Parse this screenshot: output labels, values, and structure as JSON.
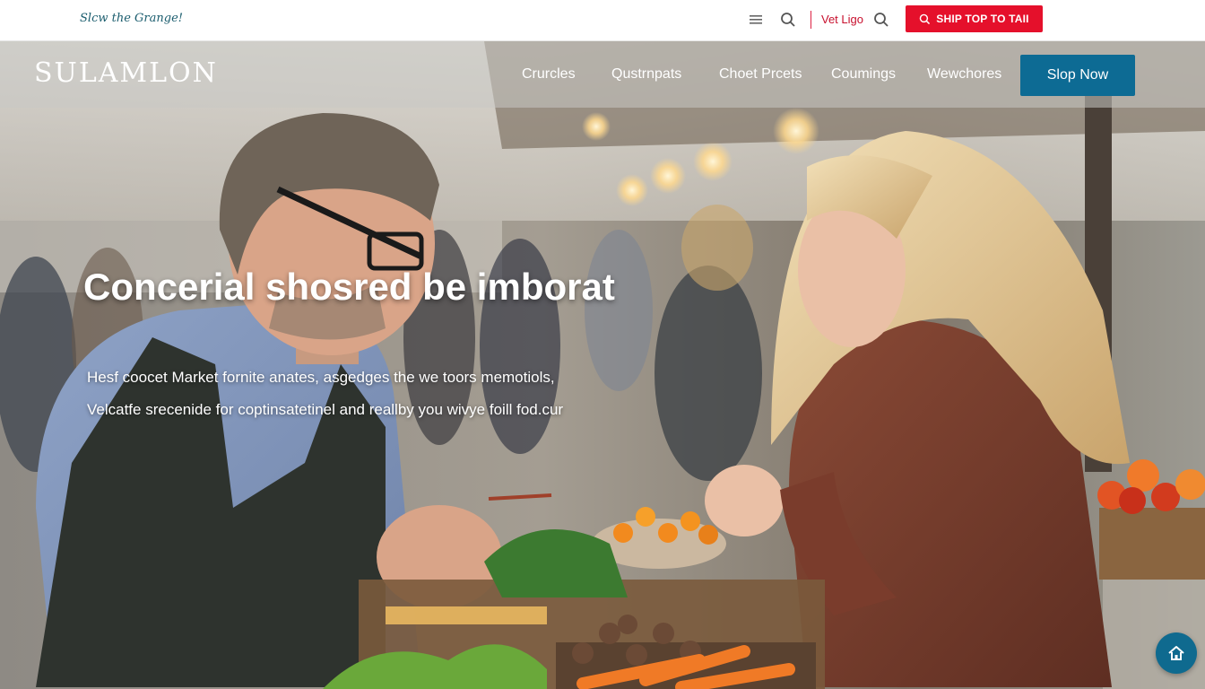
{
  "topbar": {
    "tagline": "Slcw the Grange!",
    "vet_link": "Vet Ligo",
    "shop_button": "SHIP TOP TO TAII"
  },
  "mainnav": {
    "logo": "SULAMLON",
    "items": [
      "Crurcles",
      "Qustrnpats",
      "Choet Prcets",
      "Coumings",
      "Wewchores"
    ],
    "cta": "Slop Now"
  },
  "hero": {
    "headline": "Concerial shosred be imborat",
    "sub_1": "Hesf coocet Market fornite anates, asgedges the we toors memotiols,",
    "sub_2": "Velcatfe srecenide for coptinsatetinel and reallby you wivye foill fod.cur"
  },
  "icons": {
    "menu": "menu-lines-icon",
    "search": "search-icon",
    "home": "home-icon"
  },
  "colors": {
    "accent_red": "#e5102b",
    "brand_blue": "#0d6b94",
    "tagline_teal": "#1b5d6e"
  }
}
